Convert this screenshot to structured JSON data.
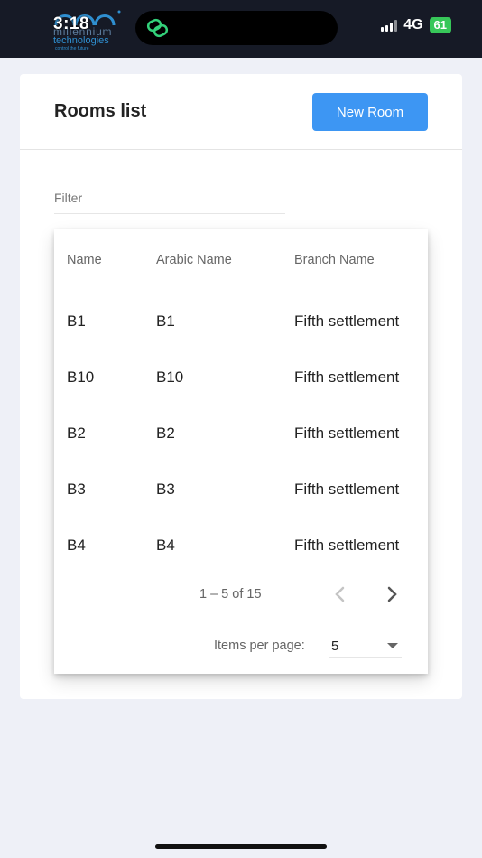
{
  "status_bar": {
    "time": "3:18",
    "brand_line1": "millennium",
    "brand_line2": "technologies",
    "brand_tagline": "control the future",
    "network": "4G",
    "battery": "61"
  },
  "page": {
    "title": "Rooms list",
    "new_room_label": "New Room",
    "filter_placeholder": "Filter"
  },
  "table": {
    "columns": [
      "Name",
      "Arabic Name",
      "Branch Name"
    ],
    "rows": [
      [
        "B1",
        "B1",
        "Fifth settlement"
      ],
      [
        "B10",
        "B10",
        "Fifth settlement"
      ],
      [
        "B2",
        "B2",
        "Fifth settlement"
      ],
      [
        "B3",
        "B3",
        "Fifth settlement"
      ],
      [
        "B4",
        "B4",
        "Fifth settlement"
      ]
    ]
  },
  "paginator": {
    "range_label": "1 – 5 of 15",
    "items_per_page_label": "Items per page:",
    "items_per_page_value": "5"
  },
  "icons": {
    "prev": "chevron-left-icon",
    "next": "chevron-right-icon",
    "dropdown": "caret-down-icon"
  },
  "colors": {
    "primary": "#3d96f3",
    "status_bar": "#161a26",
    "battery": "#37c759",
    "background": "#eef0f7"
  }
}
